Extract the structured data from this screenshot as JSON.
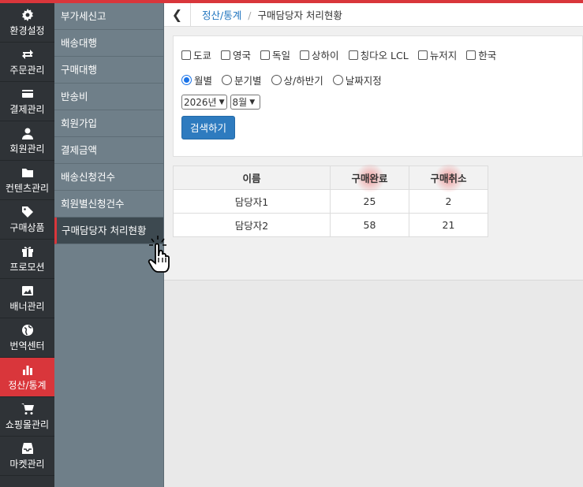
{
  "icon_menu": [
    {
      "label": "환경설정",
      "icon": "gear-icon"
    },
    {
      "label": "주문관리",
      "icon": "exchange-icon"
    },
    {
      "label": "결제관리",
      "icon": "card-icon"
    },
    {
      "label": "회원관리",
      "icon": "user-icon"
    },
    {
      "label": "컨텐츠관리",
      "icon": "folder-icon"
    },
    {
      "label": "구매상품",
      "icon": "tag-icon"
    },
    {
      "label": "프로모션",
      "icon": "gift-icon"
    },
    {
      "label": "배너관리",
      "icon": "image-icon"
    },
    {
      "label": "번역센터",
      "icon": "globe-icon"
    },
    {
      "label": "정산/통계",
      "icon": "bar-chart-icon"
    },
    {
      "label": "쇼핑몰관리",
      "icon": "cart-icon"
    },
    {
      "label": "마켓관리",
      "icon": "inbox-icon"
    }
  ],
  "sub_menu": [
    {
      "label": "부가세신고"
    },
    {
      "label": "배송대행"
    },
    {
      "label": "구매대행"
    },
    {
      "label": "반송비"
    },
    {
      "label": "회원가입"
    },
    {
      "label": "결제금액"
    },
    {
      "label": "배송신청건수"
    },
    {
      "label": "회원별신청건수"
    },
    {
      "label": "구매담당자 처리현황"
    }
  ],
  "breadcrumb": {
    "parent": "정산/통계",
    "separator": "/",
    "current": "구매담당자 처리현황"
  },
  "filters": {
    "warehouses": [
      "도쿄",
      "영국",
      "독일",
      "상하이",
      "칭다오 LCL",
      "뉴저지",
      "한국"
    ],
    "periods": [
      "월별",
      "분기별",
      "상/하반기",
      "날짜지정"
    ],
    "selected_period": "월별",
    "year": "2026년",
    "month": "8월",
    "search_label": "검색하기"
  },
  "table": {
    "headers": [
      "이름",
      "구매완료",
      "구매취소"
    ],
    "rows": [
      [
        "담당자1",
        "25",
        "2"
      ],
      [
        "담당자2",
        "58",
        "21"
      ]
    ]
  },
  "colors": {
    "accent": "#d9363b",
    "primary": "#2e7bbf"
  }
}
